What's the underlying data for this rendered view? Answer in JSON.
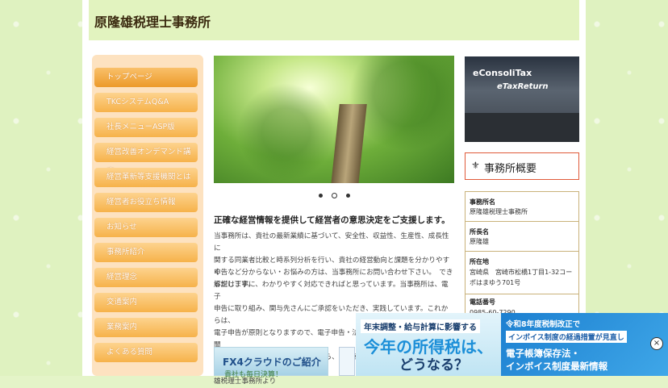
{
  "site": {
    "title": "原隆雄税理士事務所"
  },
  "nav": {
    "items": [
      "トップページ",
      "TKCシステムQ&A",
      "社長メニューASP版",
      "経営改善オンデマンド講座",
      "経営革新等支援機関とは",
      "経営者お役立ち情報",
      "お知らせ",
      "事務所紹介",
      "経営理念",
      "交通案内",
      "業務案内",
      "よくある質問"
    ]
  },
  "main": {
    "lead": "正確な経営情報を提供して経営者の意思決定をご支援します。",
    "para1_lines": [
      "当事務所は、貴社の最新業績に基づいて、安全性、収益性、生産性、成長性に",
      "関する同業者比較と時系列分析を行い、貴社の経営動向と課題を分かりやすく",
      "解説します。"
    ],
    "para2_lines": [
      "申告など分からない・お悩みの方は、当事務所にお問い合わせ下さい。　でき",
      "るだけ丁寧に、わかりやすく対応できればと思っています。当事務所は、電子",
      "申告に取り組み、関与先さんにご承認をいただき、実践しています。これからは、",
      "電子申告が原則となりますので、電子申告・法人税・所得税・贈与税など、聞",
      "きたい、分からない点がありましたら、お気軽にお問い合わせください。原隆",
      "雄税理士事務所より"
    ],
    "fx4_title": "FX4クラウドのご紹介",
    "fx4_sub": "貴社も毎日決算！"
  },
  "side": {
    "etax_line1": "eConsoliTax",
    "etax_line2": "eTaxReturn",
    "summary_title": "事務所概要",
    "info": {
      "name_label": "事務所名",
      "name_value": "原隆雄税理士事務所",
      "head_label": "所長名",
      "head_value": "原隆雄",
      "addr_label": "所在地",
      "addr_value": "宮崎県　宮崎市松橋1丁目1-32コーポはまゆう701号",
      "tel_label": "電話番号",
      "tel_value": "0985-60-7290"
    }
  },
  "ad": {
    "left_tag": "年末調整・給与計算に影響する",
    "left_main": "今年の所得税は、",
    "left_sub": "どうなる？",
    "right_l1": "令和8年度税制改正で",
    "right_l2": "インボイス制度の経過措置が見直し",
    "right_l3": "電子帳簿保存法・",
    "right_l4": "インボイス制度最新情報",
    "close": "×"
  },
  "colors": {
    "nav": "#f6b24a",
    "header": "#e2f3bf",
    "accent": "#e05a3a"
  }
}
